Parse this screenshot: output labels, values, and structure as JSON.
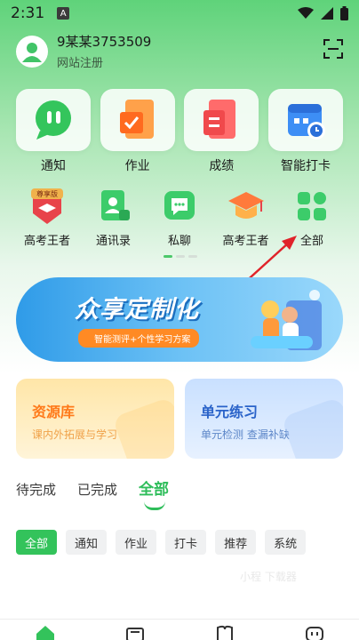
{
  "status_bar": {
    "time": "2:31",
    "notification_badge": "A"
  },
  "profile": {
    "username": "9某某3753509",
    "registration": "网站注册"
  },
  "main_features": [
    {
      "label": "通知",
      "icon": "chat-bubble-icon"
    },
    {
      "label": "作业",
      "icon": "homework-icon"
    },
    {
      "label": "成绩",
      "icon": "grade-report-icon"
    },
    {
      "label": "智能打卡",
      "icon": "calendar-checkin-icon"
    }
  ],
  "secondary_features": [
    {
      "label": "高考王者",
      "icon": "badge-icon",
      "badge": "尊享版"
    },
    {
      "label": "通讯录",
      "icon": "contacts-icon"
    },
    {
      "label": "私聊",
      "icon": "message-icon"
    },
    {
      "label": "高考王者",
      "icon": "graduation-cap-icon"
    },
    {
      "label": "全部",
      "icon": "grid-icon"
    }
  ],
  "banner": {
    "title": "众享定制化",
    "subtitle": "智能测评+个性学习方案"
  },
  "cards": {
    "resource": {
      "title": "资源库",
      "subtitle": "课内外拓展与学习"
    },
    "unit": {
      "title": "单元练习",
      "subtitle": "单元检测 查漏补缺"
    }
  },
  "status_tabs": [
    "待完成",
    "已完成",
    "全部"
  ],
  "filters": [
    "全部",
    "通知",
    "作业",
    "打卡",
    "推荐",
    "系统"
  ],
  "watermark": "小程 下载器",
  "colors": {
    "accent": "#33c35b",
    "orange": "#ff7a1a",
    "blue": "#2a63c9"
  }
}
